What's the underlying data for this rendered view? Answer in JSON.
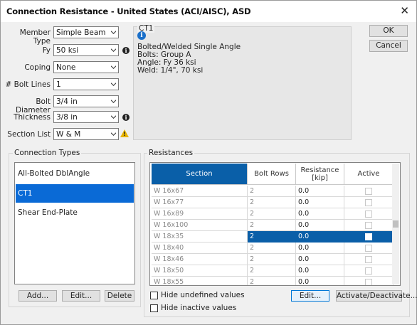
{
  "window": {
    "title": "Connection Resistance - United States (ACI/AISC), ASD",
    "close": "✕"
  },
  "form": {
    "member_type": {
      "label": "Member Type",
      "value": "Simple Beam"
    },
    "fy": {
      "label": "Fy",
      "value": "50 ksi"
    },
    "coping": {
      "label": "Coping",
      "value": "None"
    },
    "bolt_lines": {
      "label": "# Bolt Lines",
      "value": "1"
    },
    "bolt_diameter": {
      "label": "Bolt Diameter",
      "value": "3/4 in"
    },
    "thickness": {
      "label": "Thickness",
      "value": "3/8 in"
    },
    "section_list": {
      "label": "Section List",
      "value": "W & M"
    }
  },
  "ct_panel": {
    "title": "CT1",
    "lines": [
      "Bolted/Welded Single Angle",
      "Bolts: Group A",
      "Angle: Fy 36 ksi",
      "Weld: 1/4\", 70 ksi"
    ]
  },
  "buttons": {
    "ok": "OK",
    "cancel": "Cancel",
    "add": "Add...",
    "edit": "Edit...",
    "delete": "Delete",
    "grid_edit": "Edit...",
    "activate": "Activate/Deactivate..."
  },
  "connection_types": {
    "label": "Connection Types",
    "items": [
      "All-Bolted DblAngle",
      "CT1",
      "Shear End-Plate"
    ],
    "selected": 1
  },
  "resistances": {
    "label": "Resistances",
    "headers": {
      "section": "Section",
      "bolt_rows": "Bolt Rows",
      "resistance": "Resistance [kip]",
      "active": "Active"
    },
    "rows": [
      {
        "section": "W 16x67",
        "bolt_rows": "2",
        "resistance": "0.0"
      },
      {
        "section": "W 16x77",
        "bolt_rows": "2",
        "resistance": "0.0"
      },
      {
        "section": "W 16x89",
        "bolt_rows": "2",
        "resistance": "0.0"
      },
      {
        "section": "W 16x100",
        "bolt_rows": "2",
        "resistance": "0.0"
      },
      {
        "section": "W 18x35",
        "bolt_rows": "2",
        "resistance": "0.0"
      },
      {
        "section": "W 18x40",
        "bolt_rows": "2",
        "resistance": "0.0"
      },
      {
        "section": "W 18x46",
        "bolt_rows": "2",
        "resistance": "0.0"
      },
      {
        "section": "W 18x50",
        "bolt_rows": "2",
        "resistance": "0.0"
      },
      {
        "section": "W 18x55",
        "bolt_rows": "2",
        "resistance": "0.0"
      }
    ],
    "selected_row": 4
  },
  "options": {
    "hide_undefined": "Hide undefined values",
    "hide_inactive": "Hide inactive values"
  },
  "colors": {
    "selection": "#0a6ad6",
    "header_active": "#0a5fa8",
    "info_blue": "#1a6fc9",
    "warning": "#e8b400"
  },
  "icons": {
    "info": "info-icon",
    "warning": "warning-icon",
    "close": "close-icon",
    "dropdown": "chevron-down-icon"
  }
}
